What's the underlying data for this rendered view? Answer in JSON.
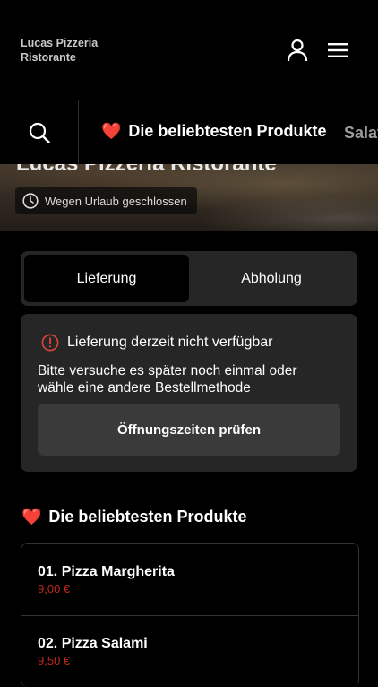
{
  "header": {
    "brand_line1": "Lucas Pizzeria",
    "brand_line2": "Ristorante",
    "user_icon": "user-icon",
    "menu_icon": "hamburger-menu-icon"
  },
  "category_bar": {
    "search_icon": "search-icon",
    "active_emoji": "❤️",
    "active_label": "Die beliebtesten Produkte",
    "next_label": "Salat"
  },
  "hero": {
    "title": "Lucas Pizzeria Ristorante",
    "status_icon": "clock-icon",
    "status_text": "Wegen Urlaub geschlossen"
  },
  "order_mode": {
    "options": [
      "Lieferung",
      "Abholung"
    ],
    "selected": "Lieferung"
  },
  "notice": {
    "icon": "info-circle-icon",
    "title": "Lieferung derzeit nicht verfügbar",
    "body": "Bitte versuche es später noch einmal oder wähle eine andere Bestellmethode",
    "button": "Öffnungszeiten prüfen"
  },
  "section": {
    "emoji": "❤️",
    "title": "Die beliebtesten Produkte"
  },
  "products": [
    {
      "name": "01. Pizza Margherita",
      "price": "9,00 €"
    },
    {
      "name": "02. Pizza Salami",
      "price": "9,50 €"
    }
  ],
  "colors": {
    "background": "#000000",
    "card": "#262626",
    "button": "#3a3a3a",
    "price": "#c0281c",
    "alert_icon": "#e0453a"
  }
}
